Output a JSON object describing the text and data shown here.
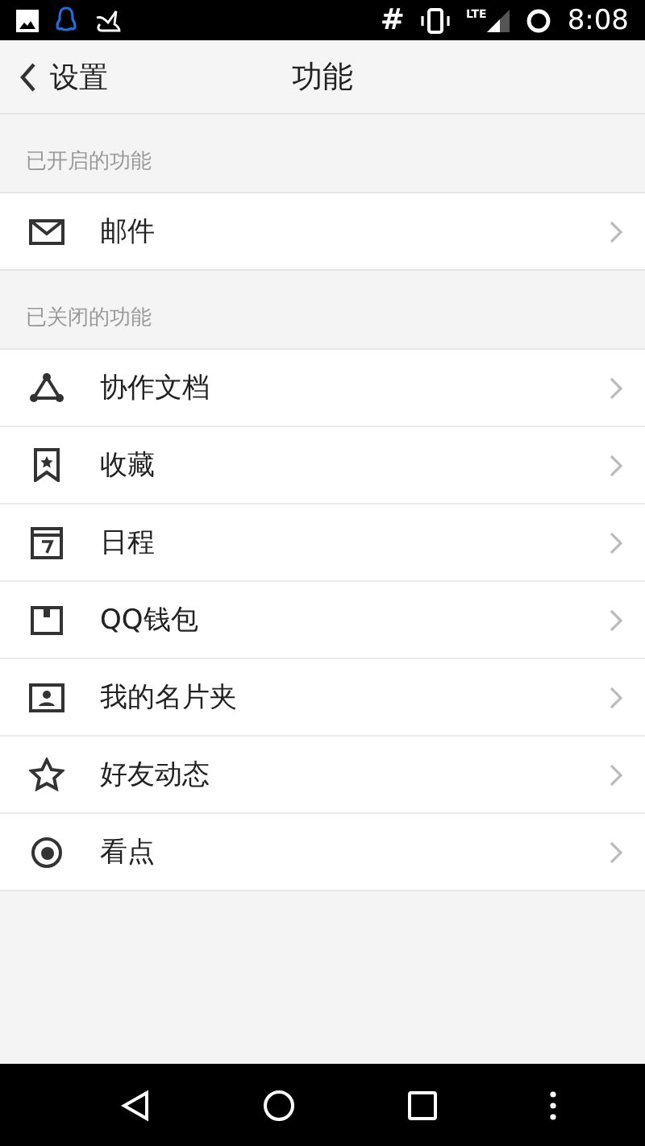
{
  "status_bar": {
    "hash": "#",
    "network": "LTE",
    "time": "8:08"
  },
  "header": {
    "back_label": "设置",
    "title": "功能"
  },
  "sections": [
    {
      "title": "已开启的功能",
      "items": [
        {
          "label": "邮件"
        }
      ]
    },
    {
      "title": "已关闭的功能",
      "items": [
        {
          "label": "协作文档"
        },
        {
          "label": "收藏"
        },
        {
          "label": "日程"
        },
        {
          "label": "QQ钱包"
        },
        {
          "label": "我的名片夹"
        },
        {
          "label": "好友动态"
        },
        {
          "label": "看点"
        }
      ]
    }
  ]
}
